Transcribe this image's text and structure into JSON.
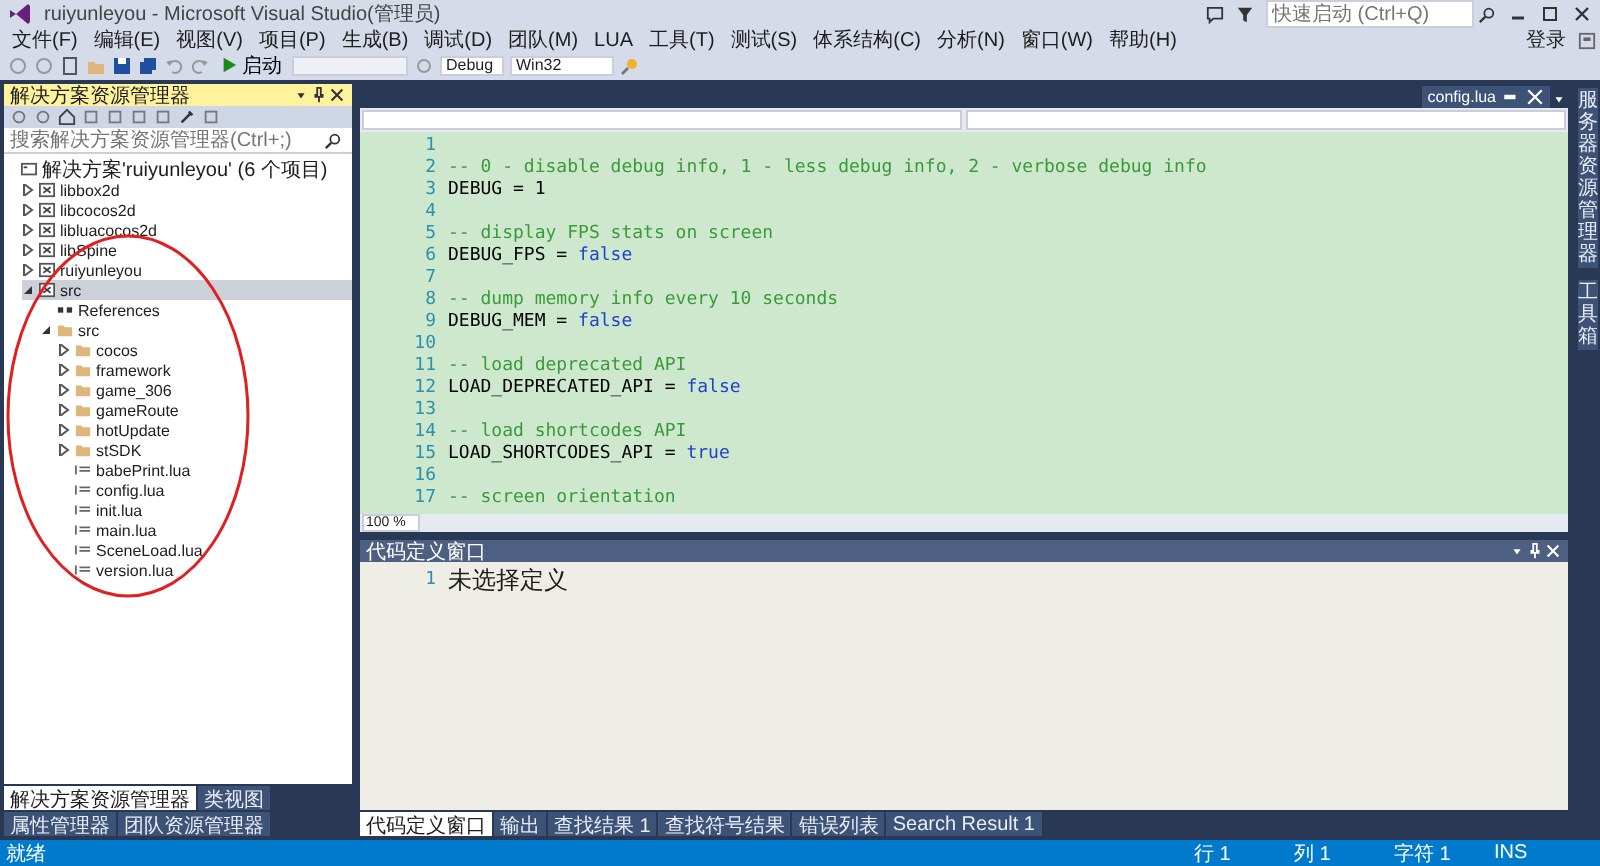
{
  "window": {
    "title": "ruiyunleyou - Microsoft Visual Studio(管理员)"
  },
  "quick_launch": {
    "placeholder": "快速启动 (Ctrl+Q)"
  },
  "account": {
    "label": "登录"
  },
  "menu": [
    "文件(F)",
    "编辑(E)",
    "视图(V)",
    "项目(P)",
    "生成(B)",
    "调试(D)",
    "团队(M)",
    "LUA",
    "工具(T)",
    "测试(S)",
    "体系结构(C)",
    "分析(N)",
    "窗口(W)",
    "帮助(H)"
  ],
  "toolbar": {
    "start_button": "启动",
    "configuration": "Debug",
    "platform": "Win32"
  },
  "solution_explorer": {
    "title": "解决方案资源管理器",
    "search": {
      "placeholder": "搜索解决方案资源管理器(Ctrl+;)"
    },
    "tree": [
      {
        "label": "解决方案'ruiyunleyou' (6 个项目)",
        "kind": "solution",
        "selected": false,
        "children": [
          {
            "label": "libbox2d",
            "kind": "project",
            "expanded": false,
            "selected": false
          },
          {
            "label": "libcocos2d",
            "kind": "project",
            "expanded": false,
            "selected": false
          },
          {
            "label": "libluacocos2d",
            "kind": "project",
            "expanded": false,
            "selected": false
          },
          {
            "label": "libSpine",
            "kind": "project",
            "expanded": false,
            "selected": false
          },
          {
            "label": "ruiyunleyou",
            "kind": "project",
            "expanded": false,
            "selected": false
          },
          {
            "label": "src",
            "kind": "project",
            "expanded": true,
            "selected": true,
            "children": [
              {
                "label": "References",
                "kind": "references",
                "selected": false
              },
              {
                "label": "src",
                "kind": "folder",
                "expanded": true,
                "selected": false,
                "children": [
                  {
                    "label": "cocos",
                    "kind": "folder",
                    "expanded": false,
                    "selected": false
                  },
                  {
                    "label": "framework",
                    "kind": "folder",
                    "expanded": false,
                    "selected": false
                  },
                  {
                    "label": "game_306",
                    "kind": "folder",
                    "expanded": false,
                    "selected": false
                  },
                  {
                    "label": "gameRoute",
                    "kind": "folder",
                    "expanded": false,
                    "selected": false
                  },
                  {
                    "label": "hotUpdate",
                    "kind": "folder",
                    "expanded": false,
                    "selected": false
                  },
                  {
                    "label": "stSDK",
                    "kind": "folder",
                    "expanded": false,
                    "selected": false
                  },
                  {
                    "label": "babePrint.lua",
                    "kind": "file",
                    "selected": false
                  },
                  {
                    "label": "config.lua",
                    "kind": "file",
                    "selected": false
                  },
                  {
                    "label": "init.lua",
                    "kind": "file",
                    "selected": false
                  },
                  {
                    "label": "main.lua",
                    "kind": "file",
                    "selected": false
                  },
                  {
                    "label": "SceneLoad.lua",
                    "kind": "file",
                    "selected": false
                  },
                  {
                    "label": "version.lua",
                    "kind": "file",
                    "selected": false
                  }
                ]
              }
            ]
          }
        ]
      }
    ],
    "tabs": [
      {
        "label": "解决方案资源管理器",
        "selected": true
      },
      {
        "label": "类视图",
        "selected": false
      },
      {
        "label": "属性管理器",
        "selected": false
      },
      {
        "label": "团队资源管理器",
        "selected": false
      }
    ]
  },
  "editor": {
    "tab": {
      "label": "config.lua"
    },
    "zoom": "100 %",
    "lines": [
      {
        "number": "1"
      },
      {
        "number": "2",
        "segments": [
          {
            "kind": "comment",
            "t": "-- 0 - disable debug info, 1 - less debug info, 2 - verbose debug info"
          }
        ]
      },
      {
        "number": "3",
        "segments": [
          {
            "kind": "text",
            "t": "DEBUG = 1"
          }
        ]
      },
      {
        "number": "4"
      },
      {
        "number": "5",
        "segments": [
          {
            "kind": "comment",
            "t": "-- display FPS stats on screen"
          }
        ]
      },
      {
        "number": "6",
        "segments": [
          {
            "kind": "text",
            "t": "DEBUG_FPS = "
          },
          {
            "kind": "keyword",
            "t": "false"
          }
        ]
      },
      {
        "number": "7"
      },
      {
        "number": "8",
        "segments": [
          {
            "kind": "comment",
            "t": "-- dump memory info every 10 seconds"
          }
        ]
      },
      {
        "number": "9",
        "segments": [
          {
            "kind": "text",
            "t": "DEBUG_MEM = "
          },
          {
            "kind": "keyword",
            "t": "false"
          }
        ]
      },
      {
        "number": "10"
      },
      {
        "number": "11",
        "segments": [
          {
            "kind": "comment",
            "t": "-- load deprecated API"
          }
        ]
      },
      {
        "number": "12",
        "segments": [
          {
            "kind": "text",
            "t": "LOAD_DEPRECATED_API = "
          },
          {
            "kind": "keyword",
            "t": "false"
          }
        ]
      },
      {
        "number": "13"
      },
      {
        "number": "14",
        "segments": [
          {
            "kind": "comment",
            "t": "-- load shortcodes API"
          }
        ]
      },
      {
        "number": "15",
        "segments": [
          {
            "kind": "text",
            "t": "LOAD_SHORTCODES_API = "
          },
          {
            "kind": "keyword",
            "t": "true"
          }
        ]
      },
      {
        "number": "16"
      },
      {
        "number": "17",
        "segments": [
          {
            "kind": "comment",
            "t": "-- screen orientation"
          }
        ]
      }
    ]
  },
  "code_definition": {
    "title": "代码定义窗口",
    "lines": [
      {
        "number": "1",
        "text": "未选择定义"
      }
    ]
  },
  "output_tabs": [
    {
      "label": "代码定义窗口",
      "selected": true
    },
    {
      "label": "输出",
      "selected": false
    },
    {
      "label": "查找结果 1",
      "selected": false
    },
    {
      "label": "查找符号结果",
      "selected": false
    },
    {
      "label": "错误列表",
      "selected": false
    },
    {
      "label": "Search Result 1",
      "selected": false
    }
  ],
  "side_tabs": [
    "服务器资源管理器",
    "工具箱"
  ],
  "status_bar": {
    "message": "就绪",
    "line": "行 1",
    "column": "列 1",
    "char": "字符 1",
    "mode": "INS"
  },
  "annotation": {
    "kind": "ellipse"
  }
}
